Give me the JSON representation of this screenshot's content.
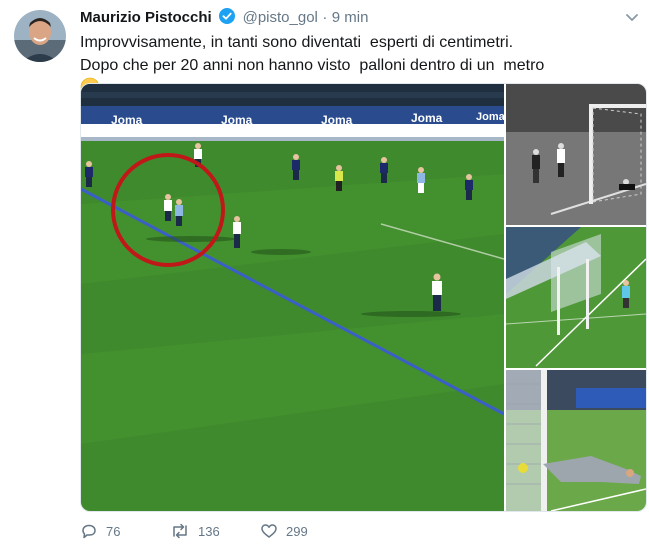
{
  "tweet": {
    "author_name": "Maurizio Pistocchi",
    "handle": "@pisto_gol",
    "separator": "·",
    "time": "9 min",
    "text": "Improvvisamente, in tanti sono diventati  esperti di centimetri. Dopo che per 20 anni non hanno visto  palloni dentro di un  metro",
    "emoji": "confused-face-icon"
  },
  "media": {
    "main_image": "football-pitch-offside-line-photo",
    "thumb_1": "goal-line-black-white-photo",
    "thumb_2": "goal-line-technology-graphic",
    "thumb_3": "goalkeeper-diving-save-photo",
    "ad_boards": [
      "Joma",
      "Joma",
      "Joma",
      "Joma",
      "Joma"
    ]
  },
  "actions": {
    "replies": "76",
    "retweets": "136",
    "likes": "299"
  },
  "colors": {
    "text": "#14171a",
    "muted": "#657786",
    "verified": "#1da1f2",
    "pitch": "#3f8a2d",
    "highlight_circle": "#c01818"
  }
}
